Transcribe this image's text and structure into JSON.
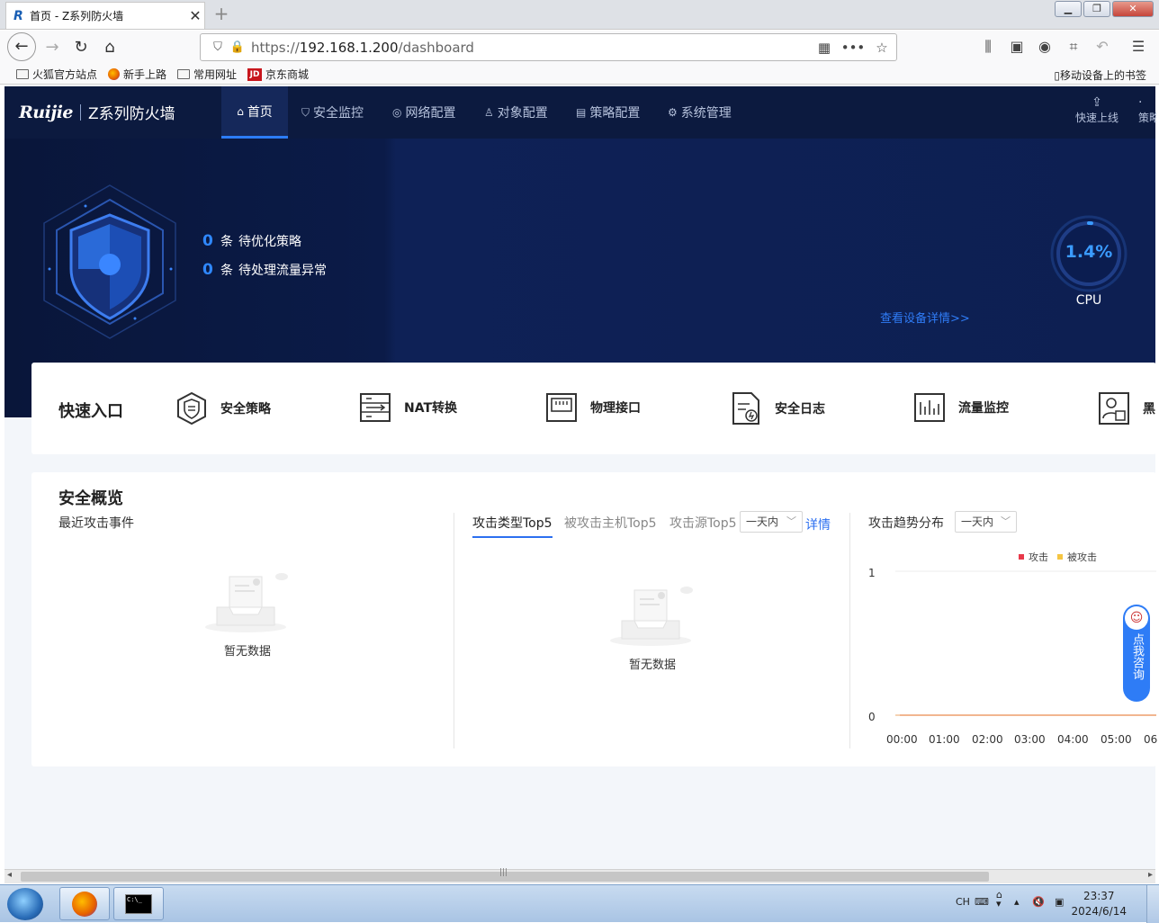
{
  "browser": {
    "tab_title": "首页 - Z系列防火墙",
    "tab_favicon": "R",
    "new_tab": "+",
    "url_prefix": "https://",
    "url_host": "192.168.1.200",
    "url_path": "/dashboard",
    "bookmarks": [
      "火狐官方站点",
      "新手上路",
      "常用网址",
      "京东商城"
    ],
    "mobile_bookmarks": "移动设备上的书签"
  },
  "app": {
    "brand": "Ruijie",
    "product": "Z系列防火墙",
    "menu": [
      "首页",
      "安全监控",
      "网络配置",
      "对象配置",
      "策略配置",
      "系统管理"
    ],
    "quick_online": "快速上线",
    "policy_cut": "策略"
  },
  "hero": {
    "stat1_num": "0",
    "stat1_unit": "条",
    "stat1_label": "待优化策略",
    "stat2_num": "0",
    "stat2_unit": "条",
    "stat2_label": "待处理流量异常",
    "cpu_value": "1.4%",
    "cpu_percent": 1.4,
    "cpu_label": "CPU",
    "device_detail_link": "查看设备详情>>"
  },
  "quick_entry": {
    "title": "快速入口",
    "items": [
      "安全策略",
      "NAT转换",
      "物理接口",
      "安全日志",
      "流量监控",
      "黑"
    ]
  },
  "overview": {
    "title": "安全概览",
    "recent_events": "最近攻击事件",
    "tabs": [
      "攻击类型Top5",
      "被攻击主机Top5",
      "攻击源Top5"
    ],
    "range_select": "一天内",
    "details_link": "详情",
    "empty_text": "暂无数据",
    "trend_title": "攻击趋势分布",
    "trend_range": "一天内"
  },
  "chart_data": {
    "type": "line",
    "title": "攻击趋势分布",
    "series": [
      {
        "name": "攻击",
        "color": "#e8394a",
        "values": [
          0,
          0,
          0,
          0,
          0,
          0,
          0
        ]
      },
      {
        "name": "被攻击",
        "color": "#f5c542",
        "values": [
          0,
          0,
          0,
          0,
          0,
          0,
          0
        ]
      }
    ],
    "categories": [
      "00:00",
      "01:00",
      "02:00",
      "03:00",
      "04:00",
      "05:00",
      "06"
    ],
    "y_ticks": [
      "1",
      "0"
    ],
    "ylim": [
      0,
      1
    ],
    "legend_position": "top-right"
  },
  "consult": {
    "label": "点我咨询"
  },
  "taskbar": {
    "lang": "CH",
    "time": "23:37",
    "date": "2024/6/14",
    "cmd_label": "C:\\_"
  }
}
